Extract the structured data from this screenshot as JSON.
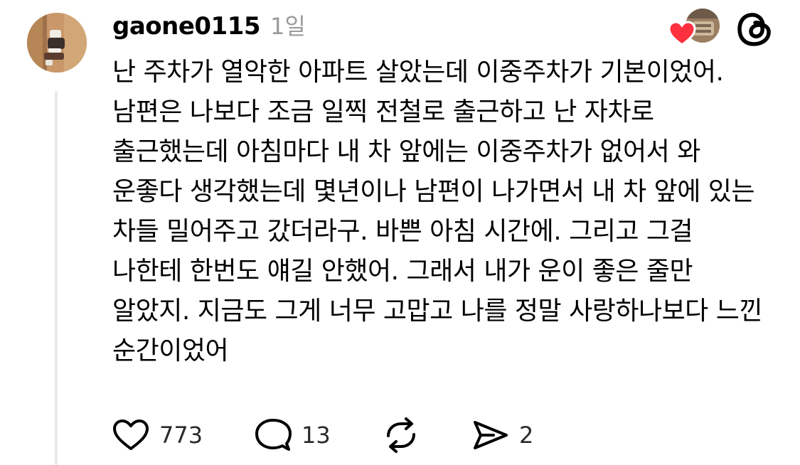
{
  "post": {
    "username": "gaone0115",
    "timestamp": "1일",
    "body": "난 주차가 열악한 아파트 살았는데 이중주차가 기본이었어. 남편은 나보다 조금 일찍 전철로 출근하고 난 자차로 출근했는데 아침마다 내 차 앞에는 이중주차가 없어서 와 운좋다 생각했는데 몇년이나 남편이 나가면서 내 차 앞에 있는 차들 밀어주고 갔더라구. 바쁜 아침 시간에. 그리고 그걸 나한테 한번도 얘길 안했어. 그래서 내가 운이 좋은 줄만 알았지. 지금도 그게 너무 고맙고 나를 정말 사랑하나보다 느낀 순간이었어"
  },
  "actions": {
    "like_count": "773",
    "reply_count": "13",
    "repost_count": "",
    "share_count": "2"
  },
  "icons": {
    "like": "heart-outline-icon",
    "reply": "speech-bubble-icon",
    "repost": "repost-arrows-icon",
    "share": "send-paper-plane-icon",
    "app": "threads-logo-icon",
    "liked_by": "heart-icon"
  },
  "colors": {
    "heart_red": "#ff3040",
    "muted_text": "#9a9a9a",
    "thread_line": "#e9e9e9"
  }
}
